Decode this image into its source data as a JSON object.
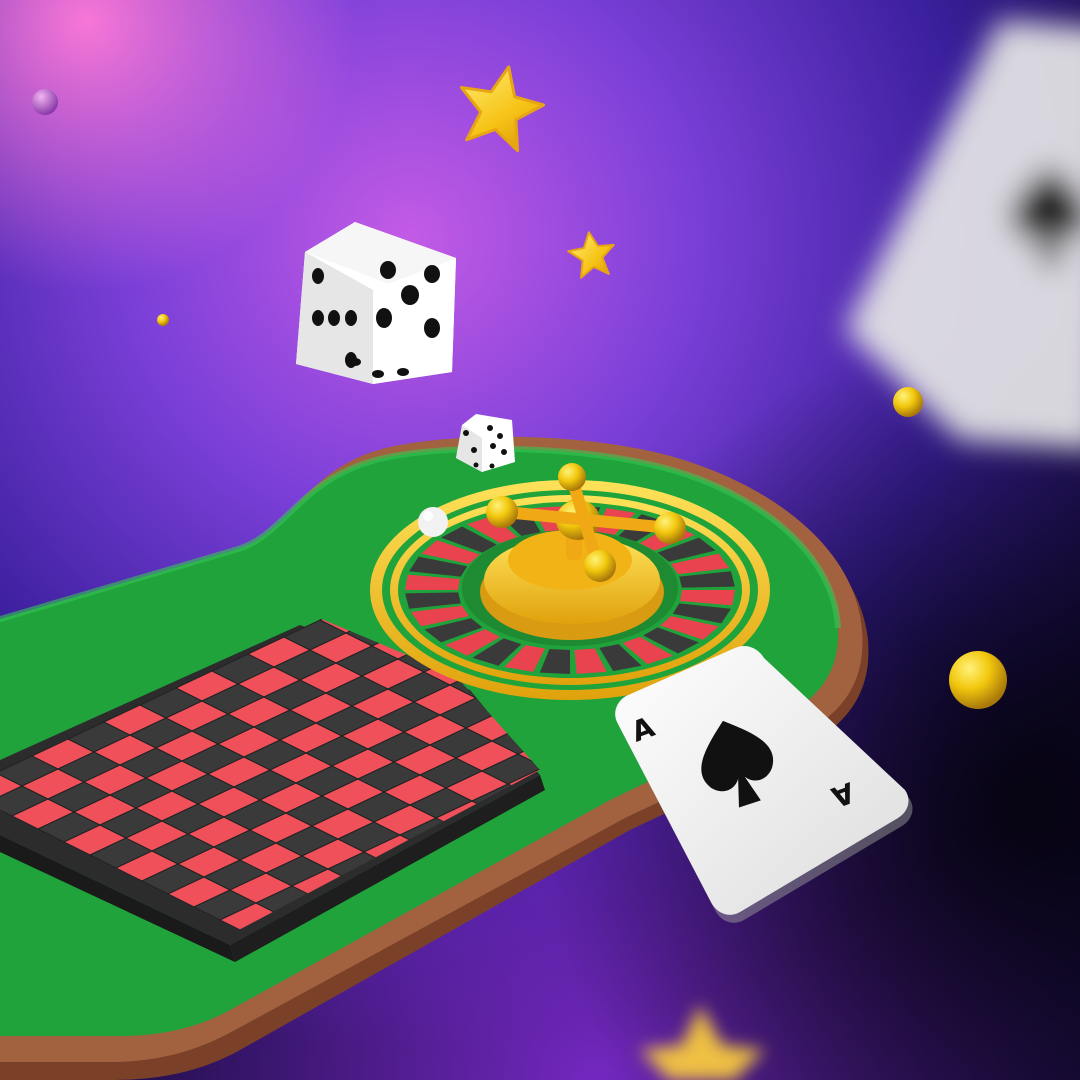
{
  "scene": {
    "subject": "casino-illustration",
    "card": {
      "rank": "A",
      "suit": "spade-icon"
    },
    "background_card": {
      "suit": "spade-icon"
    },
    "dice": [
      {
        "name": "large-die"
      },
      {
        "name": "small-die"
      }
    ],
    "colors": {
      "background_dark": "#1b1060",
      "background_glow": "#b04fe0",
      "table_felt": "#1fa33a",
      "table_rim": "#9a5a3a",
      "board_red": "#f0505a",
      "board_black": "#3a3a3a",
      "gold": "#f5c21a",
      "card_white": "#f4f4f4"
    }
  }
}
